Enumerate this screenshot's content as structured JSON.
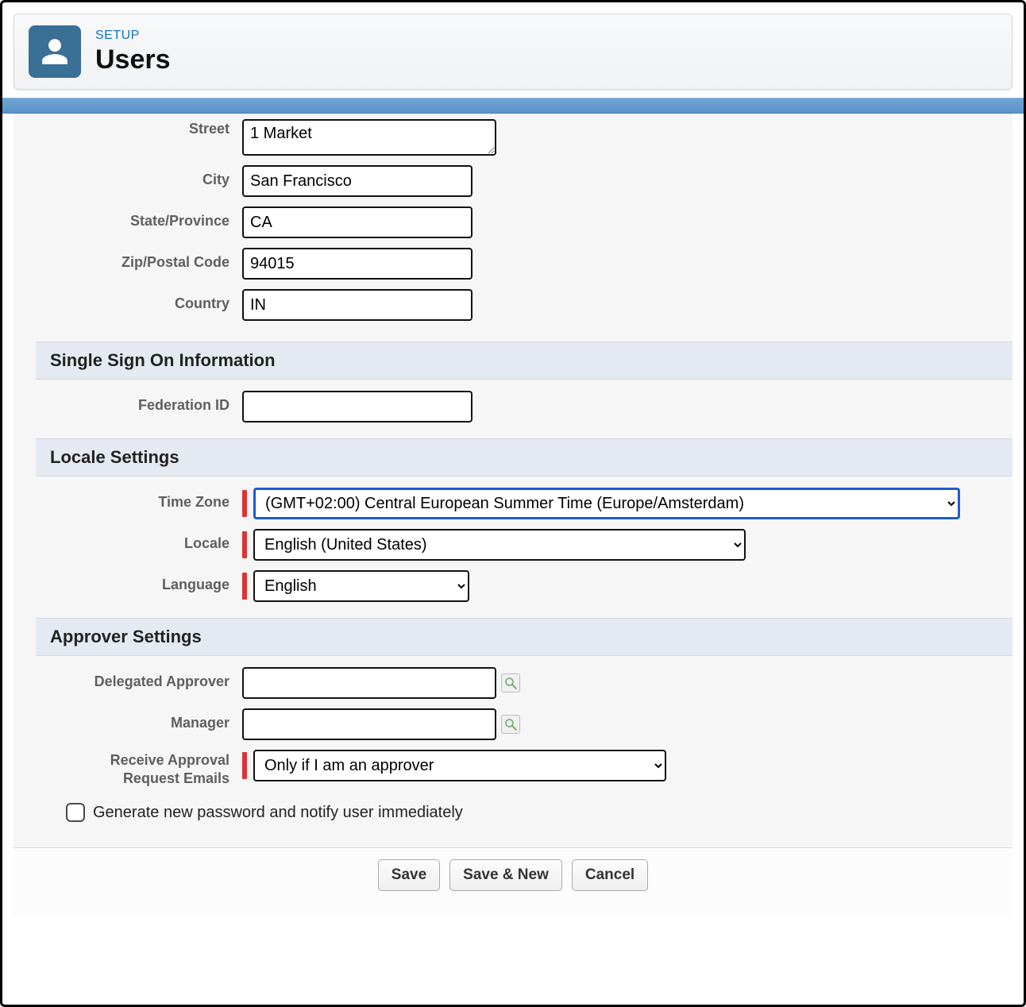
{
  "header": {
    "breadcrumb": "SETUP",
    "title": "Users"
  },
  "address": {
    "street_label": "Street",
    "street_value": "1 Market",
    "city_label": "City",
    "city_value": "San Francisco",
    "state_label": "State/Province",
    "state_value": "CA",
    "zip_label": "Zip/Postal Code",
    "zip_value": "94015",
    "country_label": "Country",
    "country_value": "IN"
  },
  "sso": {
    "section_title": "Single Sign On Information",
    "federation_label": "Federation ID",
    "federation_value": ""
  },
  "locale": {
    "section_title": "Locale Settings",
    "timezone_label": "Time Zone",
    "timezone_value": "(GMT+02:00) Central European Summer Time (Europe/Amsterdam)",
    "locale_label": "Locale",
    "locale_value": "English (United States)",
    "language_label": "Language",
    "language_value": "English"
  },
  "approver": {
    "section_title": "Approver Settings",
    "delegated_label": "Delegated Approver",
    "delegated_value": "",
    "manager_label": "Manager",
    "manager_value": "",
    "receive_label_line1": "Receive Approval",
    "receive_label_line2": "Request Emails",
    "receive_value": "Only if I am an approver"
  },
  "password_checkbox": {
    "checked": false,
    "label": "Generate new password and notify user immediately"
  },
  "footer": {
    "save": "Save",
    "save_new": "Save & New",
    "cancel": "Cancel"
  }
}
